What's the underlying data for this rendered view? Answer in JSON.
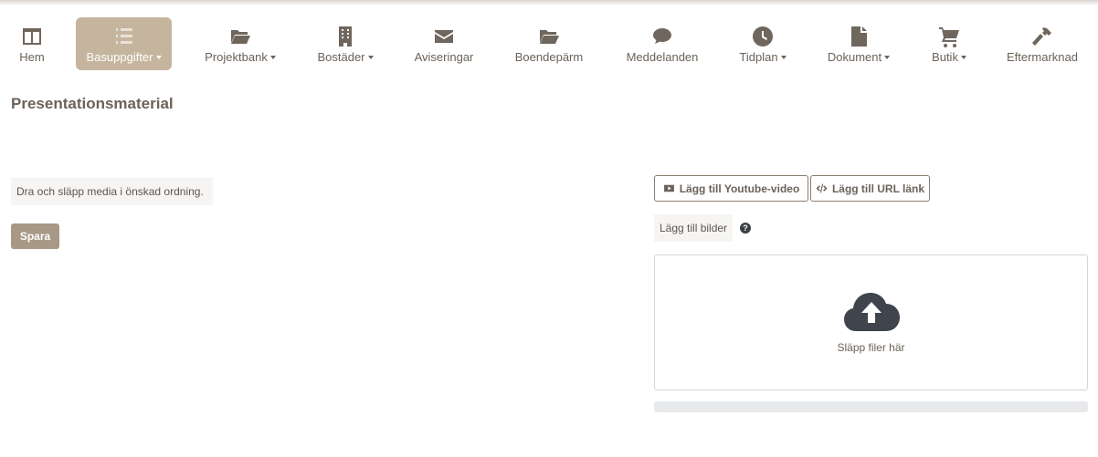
{
  "nav": {
    "items": [
      {
        "label": "Hem",
        "icon": "columns-icon",
        "dropdown": false,
        "active": false
      },
      {
        "label": "Basuppgifter",
        "icon": "list-icon",
        "dropdown": true,
        "active": true
      },
      {
        "label": "Projektbank",
        "icon": "folder-open-icon",
        "dropdown": true,
        "active": false
      },
      {
        "label": "Bostäder",
        "icon": "building-icon",
        "dropdown": true,
        "active": false
      },
      {
        "label": "Aviseringar",
        "icon": "envelope-icon",
        "dropdown": false,
        "active": false
      },
      {
        "label": "Boendepärm",
        "icon": "folder-open-icon",
        "dropdown": false,
        "active": false
      },
      {
        "label": "Meddelanden",
        "icon": "comment-icon",
        "dropdown": false,
        "active": false
      },
      {
        "label": "Tidplan",
        "icon": "clock-icon",
        "dropdown": true,
        "active": false
      },
      {
        "label": "Dokument",
        "icon": "file-icon",
        "dropdown": true,
        "active": false
      },
      {
        "label": "Butik",
        "icon": "cart-icon",
        "dropdown": true,
        "active": false
      },
      {
        "label": "Eftermarknad",
        "icon": "hammer-icon",
        "dropdown": false,
        "active": false
      }
    ]
  },
  "page": {
    "title": "Presentationsmaterial",
    "hint": "Dra och släpp media i önskad ordning.",
    "save_label": "Spara"
  },
  "media": {
    "youtube_label": "Lägg till Youtube-video",
    "url_label": "Lägg till URL länk",
    "add_images_label": "Lägg till bilder",
    "help_glyph": "?",
    "dropzone_text": "Släpp filer här",
    "upload_progress": 0
  },
  "colors": {
    "accent": "#c6b59e",
    "button": "#a89886",
    "text": "#6b6259"
  }
}
